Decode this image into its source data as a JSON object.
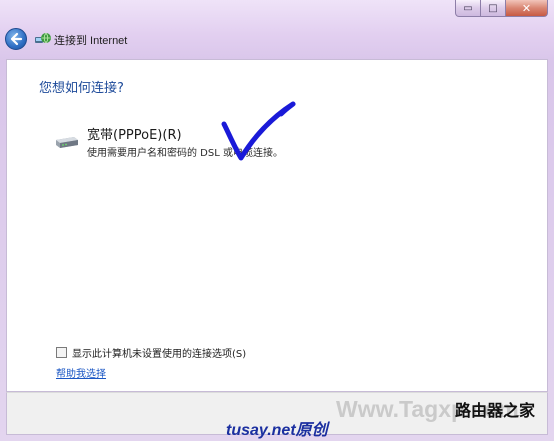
{
  "window": {
    "caption_buttons": {
      "minimize": "▭",
      "maximize": "□",
      "close": "✕"
    }
  },
  "nav": {
    "back_icon": "back-arrow-icon",
    "app_icon": "network-globe-icon",
    "title": "连接到 Internet"
  },
  "main": {
    "question": "您想如何连接?",
    "options": [
      {
        "icon": "broadband-modem-icon",
        "title": "宽带(PPPoE)(R)",
        "description": "使用需要用户名和密码的 DSL 或电缆连接。"
      }
    ],
    "annotation": "handdrawn-checkmark",
    "annotation_color": "#1a1ad8",
    "show_unconfigured_checkbox": {
      "checked": false,
      "label": "显示此计算机未设置使用的连接选项(S)"
    },
    "help_link": "帮助我选择"
  },
  "watermarks": {
    "source": "tusay.net原创",
    "site": "Www.Tagxp.com",
    "brand": "路由器之家"
  },
  "colors": {
    "window_frame": "#e2cff0",
    "heading_blue": "#1e4b9a",
    "link_blue": "#1a56c4",
    "close_red": "#c75a43"
  }
}
